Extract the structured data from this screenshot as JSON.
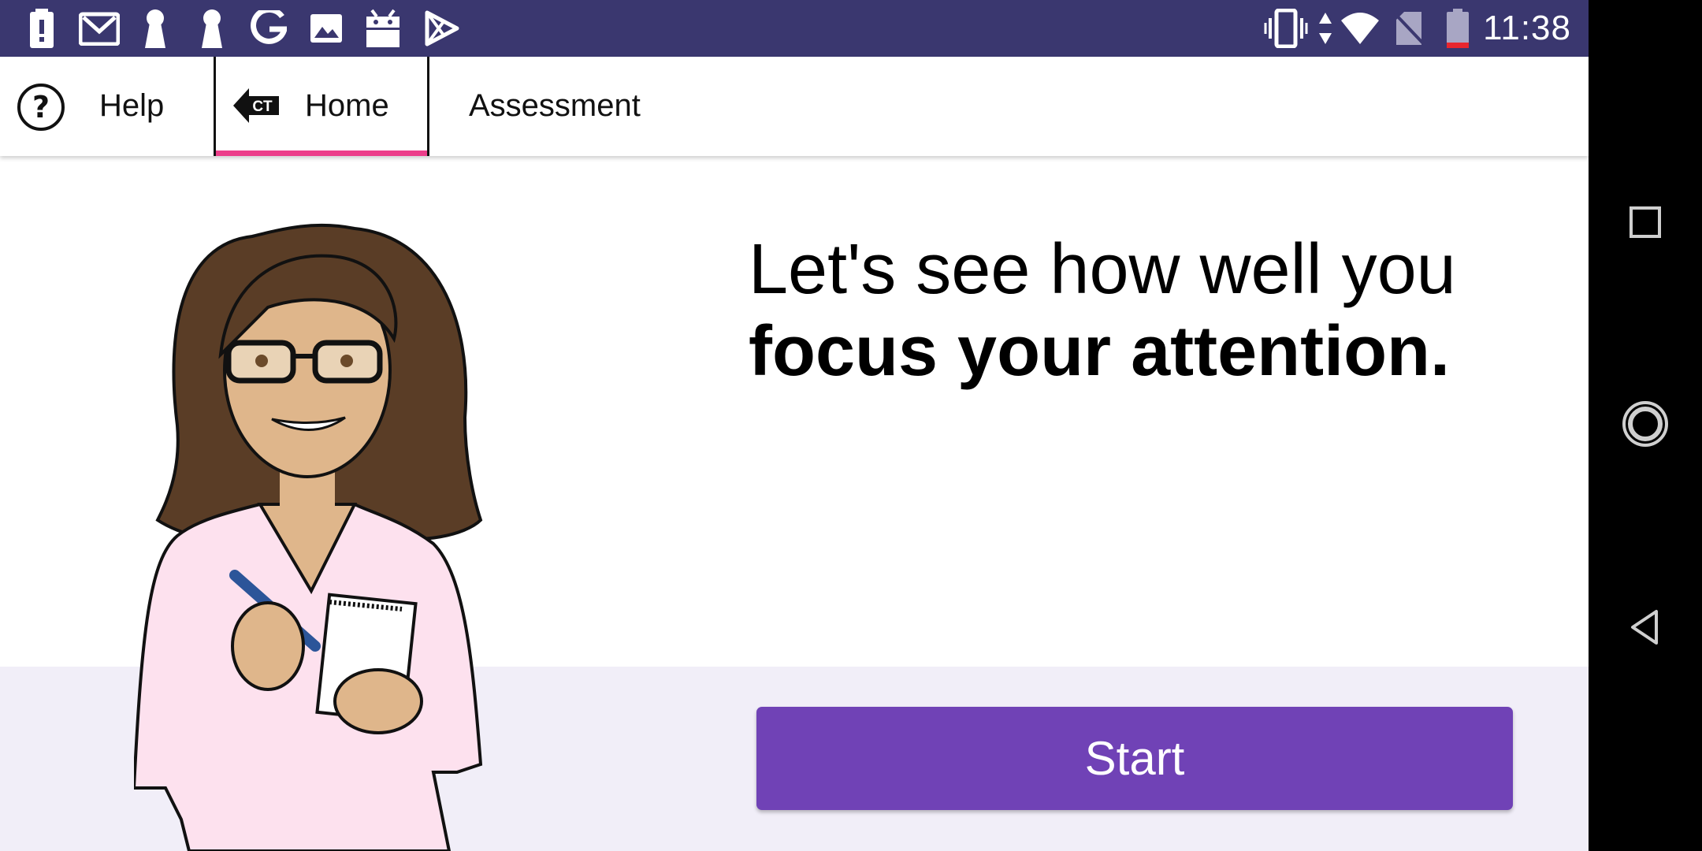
{
  "status_bar": {
    "time": "11:38",
    "left_icons": [
      "battery-alert-icon",
      "gmail-icon",
      "keyhole-icon",
      "keyhole-icon",
      "google-icon",
      "image-icon",
      "android-icon",
      "play-icon"
    ],
    "right_icons": [
      "vibrate-icon",
      "data-arrows-icon",
      "wifi-icon",
      "no-sim-icon",
      "battery-low-icon"
    ]
  },
  "tabs": [
    {
      "label": "Help",
      "icon": "help-icon"
    },
    {
      "label": "Home",
      "icon": "back-arrow-ct-icon",
      "badge": "CT",
      "selected": true
    },
    {
      "label": "Assessment"
    }
  ],
  "main": {
    "headline_line1": "Let's see how well you",
    "headline_line2": "focus your attention.",
    "start_label": "Start"
  },
  "nav_bar": [
    "overview-square-icon",
    "home-circle-icon",
    "back-triangle-icon"
  ],
  "colors": {
    "status_bar": "#3a376f",
    "accent_pink": "#ec3e8a",
    "button": "#7042b6",
    "bottom_panel": "#f1eef8"
  }
}
